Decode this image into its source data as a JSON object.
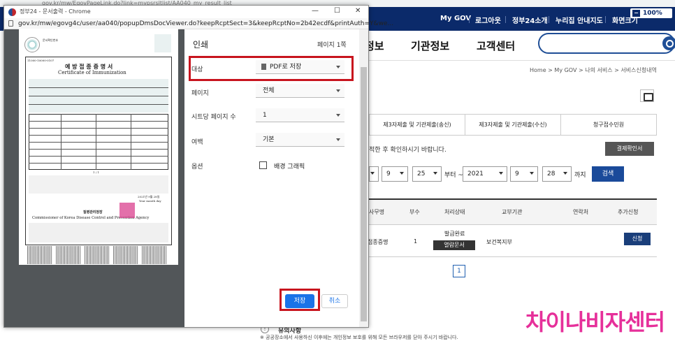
{
  "browser_bg": {
    "url": "gov.kr/mw/EgovPageLink.do?link=mypsrsltlist/AA040_my_result_list"
  },
  "utility_bar": {
    "items": [
      "My GOV",
      "로그아웃",
      "정부24소개",
      "누리집 안내지도",
      "화면크기"
    ],
    "font_size_value": "100%"
  },
  "nav": {
    "items": [
      "정보",
      "기관정보",
      "고객센터"
    ]
  },
  "breadcrumb": "Home > My GOV > 나의 서비스 > 서비스신청내역",
  "tabs": [
    "제3자제출 및 기관제출(송신)",
    "제3자제출 및 기관제출(수신)",
    "청구접수민원"
  ],
  "notice": "적한 후 확인하시기 바랍니다.",
  "confirm_button": "결제확인서",
  "date_filter": {
    "day_start": "9",
    "day_end": "25",
    "between": "부터 ~",
    "year_end": "2021",
    "month_end": "9",
    "day_end2": "28",
    "until": "까지",
    "search": "검색"
  },
  "table": {
    "headers": [
      "사무명",
      "부수",
      "처리상태",
      "교부기관",
      "연락처",
      "추가신청"
    ],
    "rows": [
      {
        "name": "접종증명",
        "count": "1",
        "status": "발급완료",
        "status_button": "열람문서",
        "agency": "보건복지부",
        "contact": "",
        "action": "신청"
      }
    ]
  },
  "pagination": {
    "current": "1"
  },
  "footer": {
    "title": "유의사항",
    "note": "※ 공공장소에서 사용하신 이후에는 개인정보 보호를 위해 모든 브라우저를 닫아 주시기 바랍니다."
  },
  "watermark": "차이나비자센터",
  "popup": {
    "title": "정부24 - 문서출력 - Chrome",
    "url": "gov.kr/mw/egovg4c/user/aa040/popupDmsDocViewer.do?keepRcptSect=3&keepRcptNo=2b42ecdf&printAuth=Y&we...",
    "print": {
      "heading": "인쇄",
      "pages_info": "페이지 1쪽",
      "destination_label": "대상",
      "destination_value": "PDF로 저장",
      "pages_label": "페이지",
      "pages_value": "전체",
      "sheets_label": "시트당 페이지 수",
      "sheets_value": "1",
      "margins_label": "여백",
      "margins_value": "기본",
      "options_label": "옵션",
      "options_value": "배경 그래픽",
      "save": "저장",
      "cancel": "취소"
    },
    "doc": {
      "issuer_small": "문서확인번호",
      "top_no": "11000-10000-0107",
      "title_ko": "예 방 접 종 증 명 서",
      "title_en": "Certificate of Immunization",
      "page_mark": "1 / 1",
      "authority_ko": "질병관리청장",
      "authority_en": "Commissioner of Korea Disease Control and Prevention Agency",
      "date_line": "2021년 9월 28일",
      "date_en": "Year  month  day"
    }
  }
}
